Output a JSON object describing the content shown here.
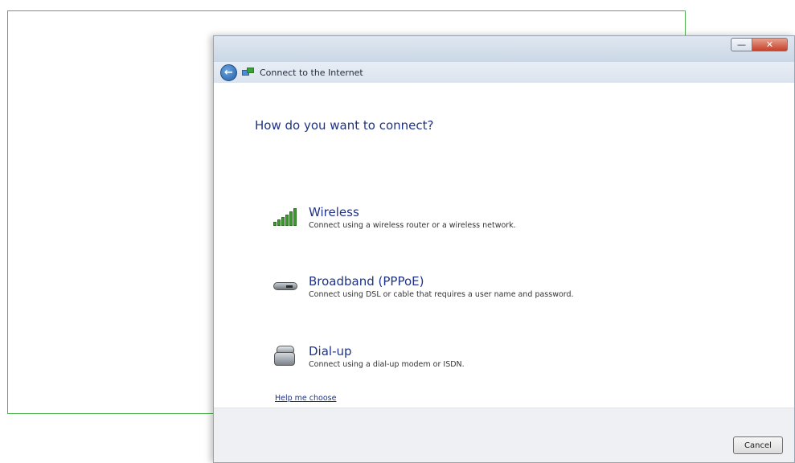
{
  "dialog": {
    "window_controls": {
      "minimize": "—",
      "close": "✕"
    },
    "nav": {
      "back_icon": "arrow-left",
      "title": "Connect to the Internet"
    },
    "question": "How do you want to connect?",
    "options": [
      {
        "title": "Wireless",
        "description": "Connect using a wireless router or a wireless network.",
        "icon": "signal-bars-icon"
      },
      {
        "title": "Broadband (PPPoE)",
        "description": "Connect using DSL or cable that requires a user name and password.",
        "icon": "modem-icon"
      },
      {
        "title": "Dial-up",
        "description": "Connect using a dial-up modem or ISDN.",
        "icon": "phone-icon"
      }
    ],
    "help_link": "Help me choose",
    "cancel_label": "Cancel"
  },
  "colors": {
    "frame_border": "#4db34d",
    "heading_blue": "#1e3287",
    "footer_bg": "#eef0f3"
  }
}
